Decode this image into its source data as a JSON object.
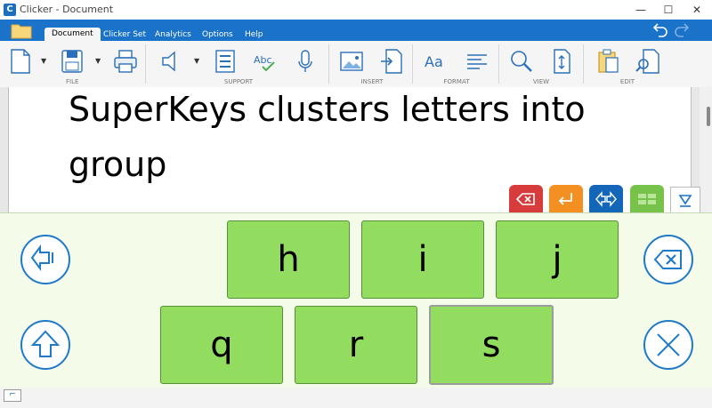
{
  "window": {
    "app_icon_letter": "C",
    "title": "Clicker - Document",
    "minimize": "—",
    "maximize": "☐",
    "close": "✕"
  },
  "ribbon": {
    "tabs": [
      "Document",
      "Clicker Set",
      "Analytics",
      "Options",
      "Help"
    ],
    "active_tab": "Document",
    "groups": [
      "FILE",
      "SUPPORT",
      "INSERT",
      "FORMAT",
      "VIEW",
      "EDIT"
    ]
  },
  "document": {
    "text": "SuperKeys clusters letters into group"
  },
  "keyboard": {
    "top_row": [
      "h",
      "i",
      "j"
    ],
    "bottom_row": [
      "q",
      "r",
      "s"
    ],
    "selected_key": "s"
  },
  "colors": {
    "ribbon_blue": "#1b73c9",
    "key_green": "#92dc5f",
    "delete_red": "#d83b3b",
    "enter_orange": "#f39021",
    "superkeys_blue": "#1366b8",
    "grid_green": "#76c24a",
    "keyboard_bg": "#f4fbe9"
  }
}
